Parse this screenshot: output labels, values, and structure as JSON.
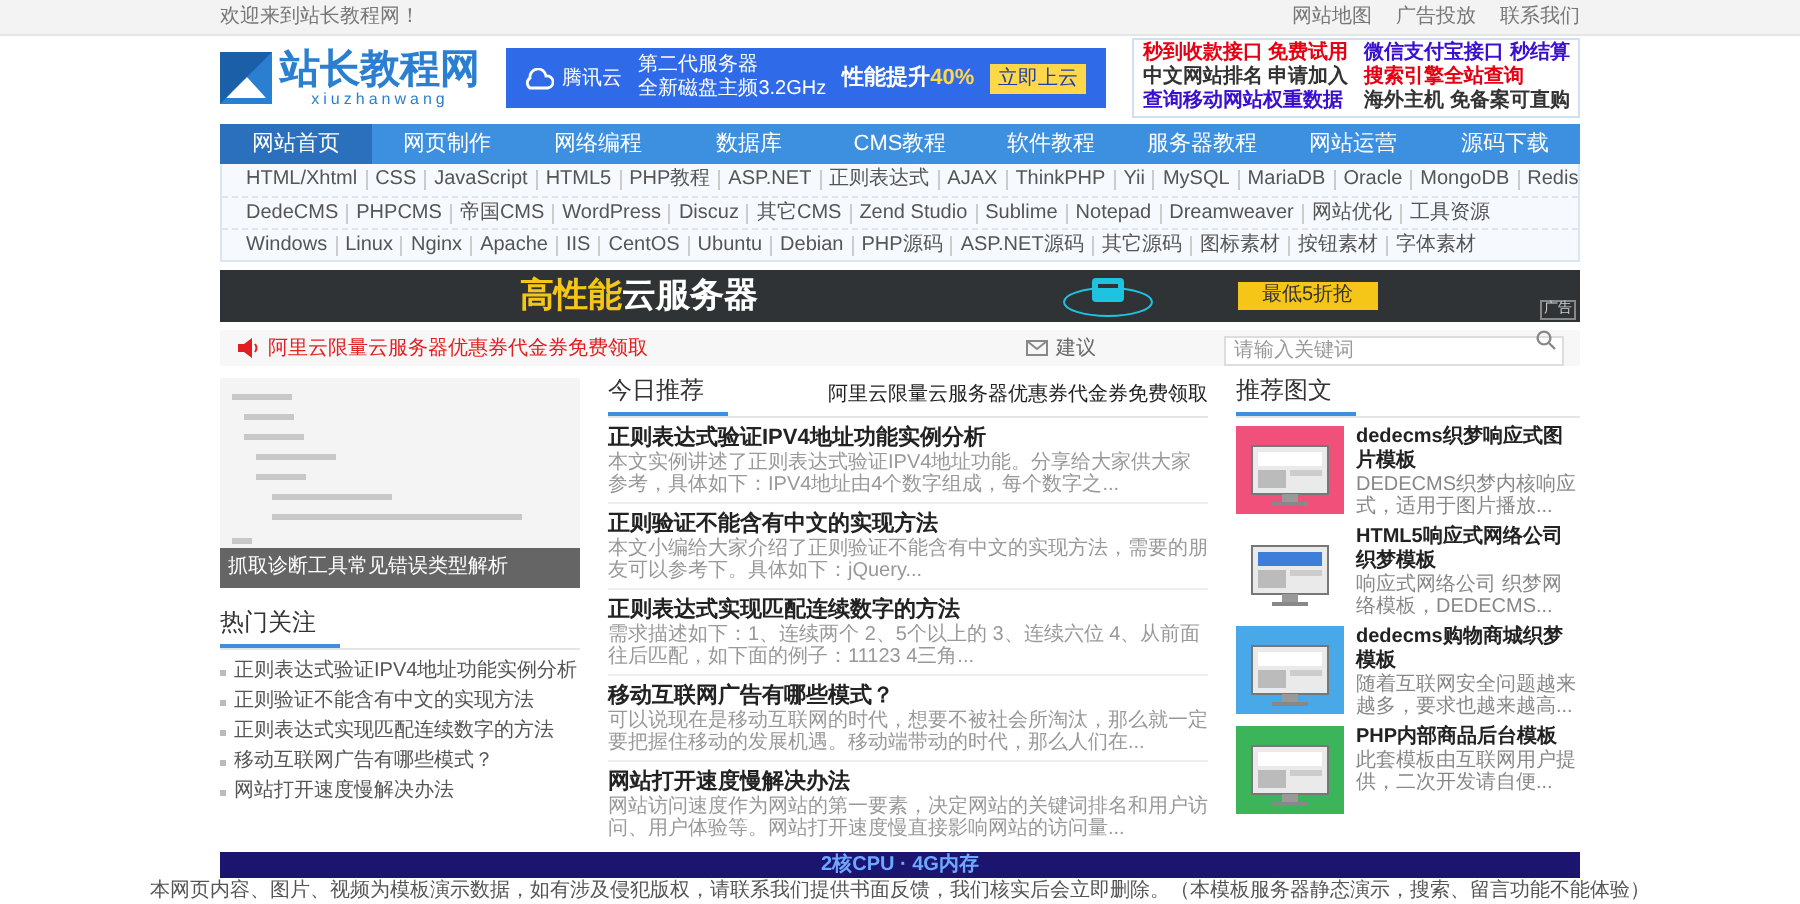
{
  "top_bar": {
    "welcome": "欢迎来到站长教程网！",
    "links": [
      "网站地图",
      "广告投放",
      "联系我们"
    ]
  },
  "header": {
    "logo": {
      "name": "站长教程网",
      "subtitle": "xiuzhanwang"
    },
    "ad": {
      "brand": "腾讯云",
      "line1": "第二代服务器",
      "line2": "全新磁盘主频3.2GHz",
      "headline": "性能提升",
      "highlight": "40%",
      "button": "立即上云"
    },
    "text_links": [
      {
        "label": "秒到收款接口 免费试用",
        "color": "#e60012"
      },
      {
        "label": "微信支付宝接口 秒结算",
        "color": "#3a0fd0"
      },
      {
        "label": "中文网站排名 申请加入",
        "color": "#333333"
      },
      {
        "label": "搜索引擎全站查询",
        "color": "#e60012"
      },
      {
        "label": "查询移动网站权重数据",
        "color": "#3a0fd0"
      },
      {
        "label": "海外主机 免备案可直购",
        "color": "#333333"
      }
    ]
  },
  "nav": {
    "items": [
      {
        "label": "网站首页",
        "selected": true
      },
      {
        "label": "网页制作",
        "selected": false
      },
      {
        "label": "网络编程",
        "selected": false
      },
      {
        "label": "数据库",
        "selected": false
      },
      {
        "label": "CMS教程",
        "selected": false
      },
      {
        "label": "软件教程",
        "selected": false
      },
      {
        "label": "服务器教程",
        "selected": false
      },
      {
        "label": "网站运营",
        "selected": false
      },
      {
        "label": "源码下载",
        "selected": false
      }
    ]
  },
  "sub_nav": {
    "rows": [
      {
        "links": [
          "HTML/Xhtml",
          "CSS",
          "JavaScript",
          "HTML5",
          "PHP教程",
          "ASP.NET",
          "正则表达式",
          "AJAX",
          "ThinkPHP",
          "Yii",
          "MySQL",
          "MariaDB",
          "Oracle",
          "MongoDB",
          "Redis"
        ]
      },
      {
        "links": [
          "DedeCMS",
          "PHPCMS",
          "帝国CMS",
          "WordPress",
          "Discuz",
          "其它CMS",
          "Zend Studio",
          "Sublime",
          "Notepad",
          "Dreamweaver",
          "网站优化",
          "工具资源"
        ]
      },
      {
        "links": [
          "Windows",
          "Linux",
          "Nginx",
          "Apache",
          "IIS",
          "CentOS",
          "Ubuntu",
          "Debian",
          "PHP源码",
          "ASP.NET源码",
          "其它源码",
          "图标素材",
          "按钮素材",
          "字体素材"
        ]
      }
    ]
  },
  "banner": {
    "highlight": "高性能",
    "text": "云服务器",
    "button": "最低5折抢",
    "badge": "广告"
  },
  "notice": {
    "text": "阿里云限量云服务器优惠券代金券免费领取",
    "feedback": "建议",
    "search": {
      "placeholder": "请输入关键词"
    }
  },
  "left": {
    "feature": {
      "kind": "picture",
      "caption": "抓取诊断工具常见错误类型解析"
    },
    "hot": {
      "title": "热门关注",
      "items": [
        "正则表达式验证IPV4地址功能实例分析",
        "正则验证不能含有中文的实现方法",
        "正则表达式实现匹配连续数字的方法",
        "移动互联网广告有哪些模式？",
        "网站打开速度慢解决办法"
      ]
    }
  },
  "middle": {
    "title": "今日推荐",
    "link": "阿里云限量云服务器优惠券代金券免费领取",
    "articles": [
      {
        "title": "正则表达式验证IPV4地址功能实例分析",
        "summary": "本文实例讲述了正则表达式验证IPV4地址功能。分享给大家供大家参考，具体如下：IPV4地址由4个数字组成，每个数字之..."
      },
      {
        "title": "正则验证不能含有中文的实现方法",
        "summary": "本文小编给大家介绍了正则验证不能含有中文的实现方法，需要的朋友可以参考下。具体如下：jQuery..."
      },
      {
        "title": "正则表达式实现匹配连续数字的方法",
        "summary": "需求描述如下：1、连续两个 2、5个以上的 3、连续六位 4、从前面往后匹配，如下面的例子：11123 4三角..."
      },
      {
        "title": "移动互联网广告有哪些模式？",
        "summary": "可以说现在是移动互联网的时代，想要不被社会所淘汰，那么就一定要把握住移动的发展机遇。移动端带动的时代，那么人们在..."
      },
      {
        "title": "网站打开速度慢解决办法",
        "summary": "网站访问速度作为网站的第一要素，决定网站的关键词排名和用户访问、用户体验等。网站打开速度慢直接影响网站的访问量..."
      }
    ]
  },
  "right": {
    "title": "推荐图文",
    "items": [
      {
        "title": "dedecms织梦响应式图片模板",
        "summary": "DEDECMS织梦内核响应式，适用于图片播放..."
      },
      {
        "title": "HTML5响应式网络公司织梦模板",
        "summary": "响应式网络公司 织梦网络模板，DEDECMS..."
      },
      {
        "title": "dedecms购物商城织梦模板",
        "summary": "随着互联网安全问题越来越多，要求也越来越高..."
      },
      {
        "title": "PHP内部商品后台模板",
        "summary": "此套模板由互联网用户提供，二次开发请自便..."
      }
    ]
  },
  "bottom_ad": {
    "text": "2核CPU · 4G内存"
  },
  "footer": {
    "text": "本网页内容、图片、视频为模板演示数据，如有涉及侵犯版权，请联系我们提供书面反馈，我们核实后会立即删除。（本模板服务器静态演示，搜索、留言功能不能体验）"
  }
}
